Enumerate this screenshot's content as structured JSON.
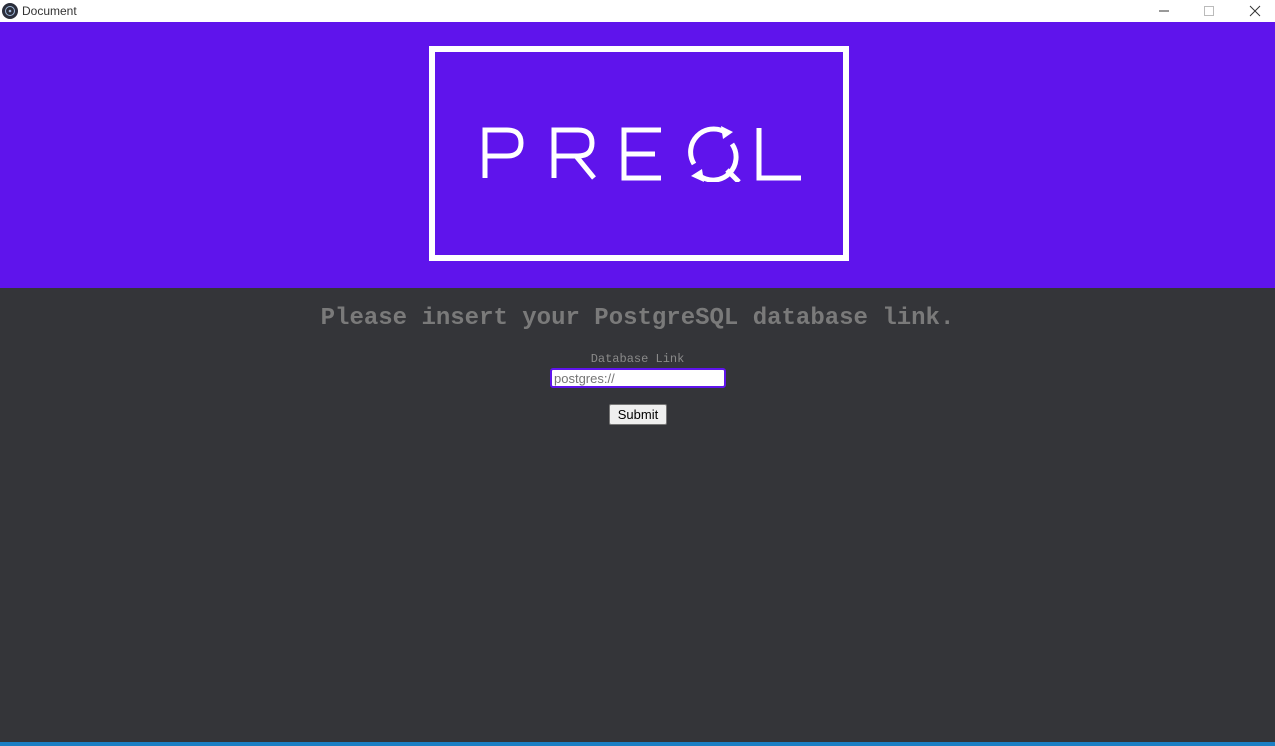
{
  "window": {
    "title": "Document",
    "icon": "electron-app-icon"
  },
  "header": {
    "logo_text": "PREQL",
    "background": "#5f14ec"
  },
  "main": {
    "prompt": "Please insert your PostgreSQL database link.",
    "field_label": "Database Link",
    "input_value": "",
    "input_placeholder": "postgres://",
    "submit_label": "Submit"
  },
  "colors": {
    "brand": "#5f14ec",
    "background": "#343539",
    "text_muted": "#7a7a7a"
  }
}
